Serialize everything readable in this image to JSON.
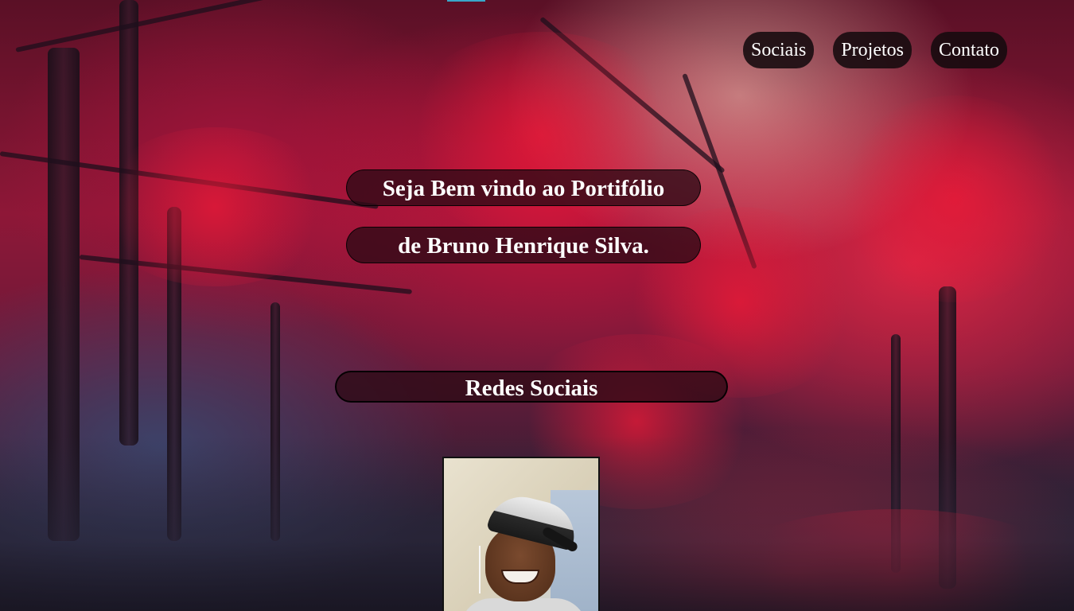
{
  "nav": {
    "items": [
      {
        "label": "Sociais"
      },
      {
        "label": "Projetos"
      },
      {
        "label": "Contato"
      }
    ]
  },
  "hero": {
    "line1": "Seja Bem vindo ao Portifólio",
    "line2": "de Bruno Henrique Silva."
  },
  "social_section": {
    "title": "Redes Sociais"
  },
  "colors": {
    "accent": "#39a7c9",
    "pill_background": "#140a0e",
    "text": "#ffffff"
  }
}
